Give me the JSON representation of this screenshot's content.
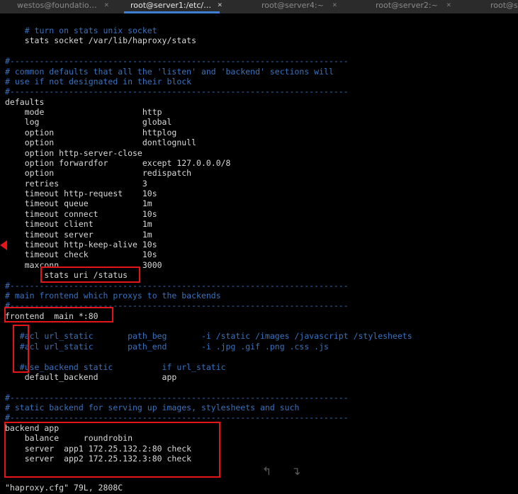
{
  "tabs": [
    {
      "label": "westos@foundatio…",
      "active": false
    },
    {
      "label": "root@server1:/etc/…",
      "active": true
    },
    {
      "label": "root@server4:~",
      "active": false
    },
    {
      "label": "root@server2:~",
      "active": false
    },
    {
      "label": "root@s",
      "active": false
    }
  ],
  "tab_close_glyph": "×",
  "editor": {
    "lines": [
      {
        "text": "    # turn on stats unix socket",
        "comment": true
      },
      {
        "text": "    stats socket /var/lib/haproxy/stats",
        "comment": false
      },
      {
        "text": "",
        "comment": false
      },
      {
        "text": "#---------------------------------------------------------------------",
        "comment": true
      },
      {
        "text": "# common defaults that all the 'listen' and 'backend' sections will",
        "comment": true
      },
      {
        "text": "# use if not designated in their block",
        "comment": true
      },
      {
        "text": "#---------------------------------------------------------------------",
        "comment": true
      },
      {
        "text": "defaults",
        "comment": false
      },
      {
        "text": "    mode                    http",
        "comment": false
      },
      {
        "text": "    log                     global",
        "comment": false
      },
      {
        "text": "    option                  httplog",
        "comment": false
      },
      {
        "text": "    option                  dontlognull",
        "comment": false
      },
      {
        "text": "    option http-server-close",
        "comment": false
      },
      {
        "text": "    option forwardfor       except 127.0.0.0/8",
        "comment": false
      },
      {
        "text": "    option                  redispatch",
        "comment": false
      },
      {
        "text": "    retries                 3",
        "comment": false
      },
      {
        "text": "    timeout http-request    10s",
        "comment": false
      },
      {
        "text": "    timeout queue           1m",
        "comment": false
      },
      {
        "text": "    timeout connect         10s",
        "comment": false
      },
      {
        "text": "    timeout client          1m",
        "comment": false
      },
      {
        "text": "    timeout server          1m",
        "comment": false
      },
      {
        "text": "    timeout http-keep-alive 10s",
        "comment": false
      },
      {
        "text": "    timeout check           10s",
        "comment": false
      },
      {
        "text": "    maxconn                 3000",
        "comment": false
      },
      {
        "text": "        stats uri /status",
        "comment": false
      },
      {
        "text": "#---------------------------------------------------------------------",
        "comment": true
      },
      {
        "text": "# main frontend which proxys to the backends",
        "comment": true
      },
      {
        "text": "#---------------------------------------------------------------------",
        "comment": true
      },
      {
        "text": "frontend  main *:80",
        "comment": false
      },
      {
        "text": "",
        "comment": false
      },
      {
        "text": "   #acl url_static       path_beg       -i /static /images /javascript /stylesheets",
        "comment": true
      },
      {
        "text": "   #acl url_static       path_end       -i .jpg .gif .png .css .js",
        "comment": true
      },
      {
        "text": "",
        "comment": false
      },
      {
        "text": "   #use_backend static          if url_static",
        "comment": true
      },
      {
        "text": "    default_backend             app",
        "comment": false
      },
      {
        "text": "",
        "comment": false
      },
      {
        "text": "#---------------------------------------------------------------------",
        "comment": true
      },
      {
        "text": "# static backend for serving up images, stylesheets and such",
        "comment": true
      },
      {
        "text": "#---------------------------------------------------------------------",
        "comment": true
      },
      {
        "text": "backend app",
        "comment": false
      },
      {
        "text": "    balance     roundrobin",
        "comment": false
      },
      {
        "text": "    server  app1 172.25.132.2:80 check",
        "comment": false
      },
      {
        "text": "    server  app2 172.25.132.3:80 check",
        "comment": false
      }
    ]
  },
  "statusbar": {
    "text": "\"haproxy.cfg\" 79L, 2808C"
  },
  "scroll_icons": {
    "up": "↰",
    "down": "↴"
  },
  "colors": {
    "comment": "#3a72bd",
    "text": "#d8d8d8",
    "highlight": "#e5141a",
    "active_tab_underline": "#3e7fd6"
  }
}
